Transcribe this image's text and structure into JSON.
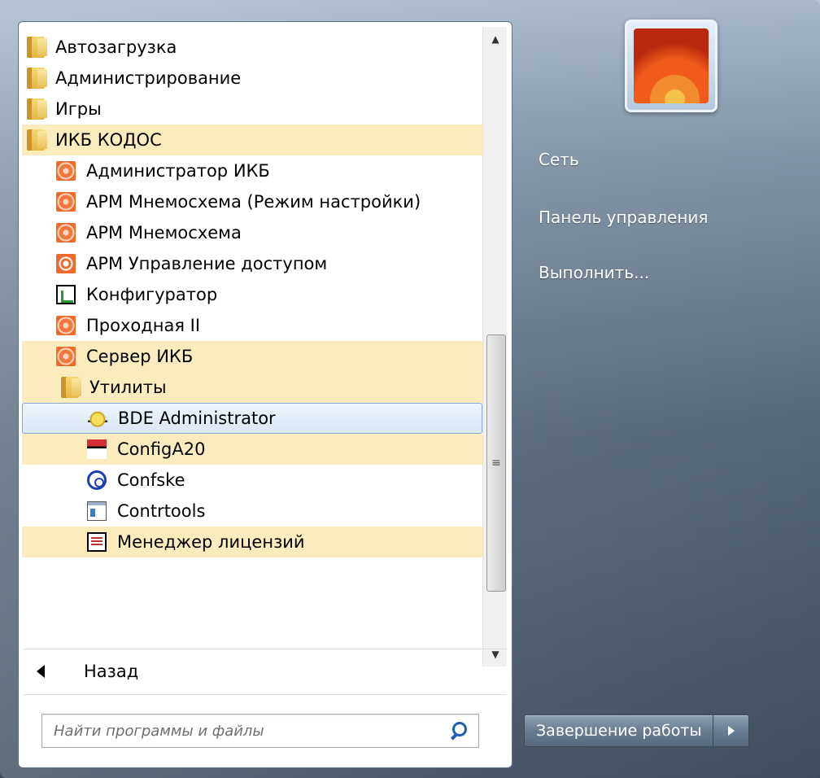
{
  "programs": {
    "items": [
      {
        "label": "Автозагрузка",
        "icon": "folder-icon"
      },
      {
        "label": "Администрирование",
        "icon": "folder-icon"
      },
      {
        "label": "Игры",
        "icon": "folder-icon"
      },
      {
        "label": "ИКБ КОДОС",
        "icon": "folder-icon"
      },
      {
        "label": "Администратор ИКБ",
        "icon": "kodos-icon"
      },
      {
        "label": "АРМ Мнемосхема (Режим настройки)",
        "icon": "kodos-icon"
      },
      {
        "label": "АРМ Мнемосхема",
        "icon": "kodos-icon"
      },
      {
        "label": "АРМ Управление доступом",
        "icon": "target-icon"
      },
      {
        "label": "Конфигуратор",
        "icon": "configurator-icon"
      },
      {
        "label": "Проходная II",
        "icon": "kodos-icon"
      },
      {
        "label": "Сервер ИКБ",
        "icon": "kodos-icon"
      },
      {
        "label": "Утилиты",
        "icon": "folder-icon"
      },
      {
        "label": "BDE Administrator",
        "icon": "bde-icon"
      },
      {
        "label": "ConfigA20",
        "icon": "a20-icon"
      },
      {
        "label": "Confske",
        "icon": "confske-icon"
      },
      {
        "label": "Contrtools",
        "icon": "window-icon"
      },
      {
        "label": "Менеджер лицензий",
        "icon": "license-icon"
      }
    ]
  },
  "back_label": "Назад",
  "search": {
    "placeholder": "Найти программы и файлы"
  },
  "right": {
    "network": "Сеть",
    "control_panel": "Панель управления",
    "run": "Выполнить..."
  },
  "shutdown": {
    "label": "Завершение работы"
  },
  "colors": {
    "highlight": "#fcebbd",
    "selected": "#dae7f7",
    "link": "#1d5fae"
  }
}
